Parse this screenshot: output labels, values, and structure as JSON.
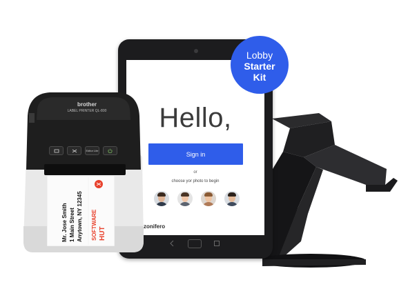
{
  "tablet": {
    "greeting": "Hello,",
    "sign_in_label": "Sign in",
    "or_label": "or",
    "choose_photo_label": "choose yor photo to begin",
    "brand_name": "zonifero",
    "avatars": [
      "avatar-1",
      "avatar-2",
      "avatar-3",
      "avatar-4"
    ]
  },
  "badge": {
    "line1": "Lobby",
    "line2": "Starter",
    "line3": "Kit"
  },
  "printer": {
    "brand": "brother",
    "model": "LABEL PRINTER QL-800",
    "buttons": [
      "cut-icon",
      "editor-lite",
      "power-icon"
    ],
    "editor_lite_label": "Editor Lite"
  },
  "label": {
    "line1": "Mr. Jose Smith",
    "line2": "1 Main Street",
    "line3": "Anytown, NY 12345",
    "logo_word1": "SOFTWARE",
    "logo_word2": "HUT"
  },
  "colors": {
    "accent": "#2f5dea",
    "printer_body": "#1e1e1e",
    "printer_base": "#e9e9e9",
    "logo_red": "#e8412c"
  }
}
